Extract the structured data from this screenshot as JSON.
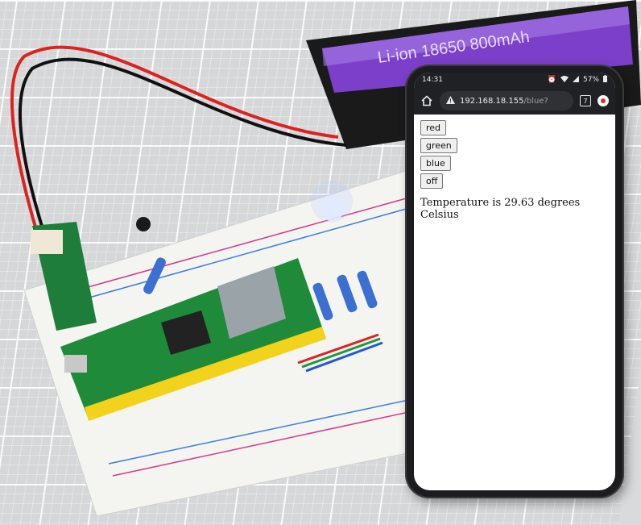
{
  "status_bar": {
    "time": "14:31",
    "battery": "57%"
  },
  "browser": {
    "url_host": "192.168.18.155",
    "url_path": "/blue?",
    "tab_count": "7"
  },
  "page": {
    "buttons": [
      "red",
      "green",
      "blue",
      "off"
    ],
    "temperature_text": "Temperature is 29.63 degrees Celsius"
  },
  "photo": {
    "battery_label": "Li-ion 18650 800mAh"
  }
}
